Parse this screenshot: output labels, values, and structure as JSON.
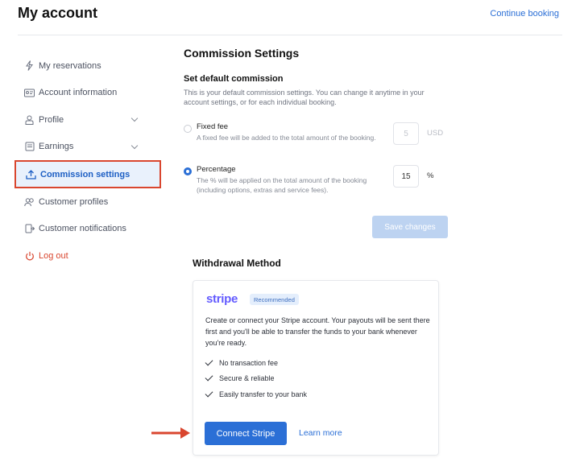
{
  "header": {
    "title": "My account",
    "continue_link": "Continue booking"
  },
  "sidebar": {
    "items": [
      {
        "label": "My reservations",
        "icon": "bolt-icon"
      },
      {
        "label": "Account information",
        "icon": "id-card-icon"
      },
      {
        "label": "Profile",
        "icon": "user-icon"
      },
      {
        "label": "Earnings",
        "icon": "wallet-icon"
      },
      {
        "label": "Commission settings",
        "icon": "upload-tray-icon"
      },
      {
        "label": "Customer profiles",
        "icon": "users-icon"
      },
      {
        "label": "Customer notifications",
        "icon": "notification-icon"
      },
      {
        "label": "Log out",
        "icon": "power-icon"
      }
    ],
    "active": "Commission settings",
    "highlight_color": "#d9462f"
  },
  "commission": {
    "title": "Commission Settings",
    "subtitle": "Set default commission",
    "help": "This is your default commission settings. You can change it anytime in your account settings, or for each individual booking.",
    "fixed": {
      "label": "Fixed fee",
      "description": "A fixed fee will be added to the total amount of the booking.",
      "value": "5",
      "unit": "USD",
      "selected": false
    },
    "percentage": {
      "label": "Percentage",
      "description": "The % will be applied on the total amount of the booking (including options, extras and service fees).",
      "value": "15",
      "unit": "%",
      "selected": true
    },
    "save_label": "Save changes"
  },
  "withdrawal": {
    "title": "Withdrawal Method",
    "provider": "stripe",
    "badge": "Recommended",
    "description": "Create or connect your Stripe account. Your payouts will be sent there first and you'll be able to transfer the funds to your bank whenever you're ready.",
    "features": [
      "No transaction fee",
      "Secure & reliable",
      "Easily transfer to your bank"
    ],
    "connect_label": "Connect Stripe",
    "learn_label": "Learn more"
  },
  "colors": {
    "accent": "#2b6fd6",
    "stripe": "#635bff",
    "annotation": "#d9462f"
  }
}
